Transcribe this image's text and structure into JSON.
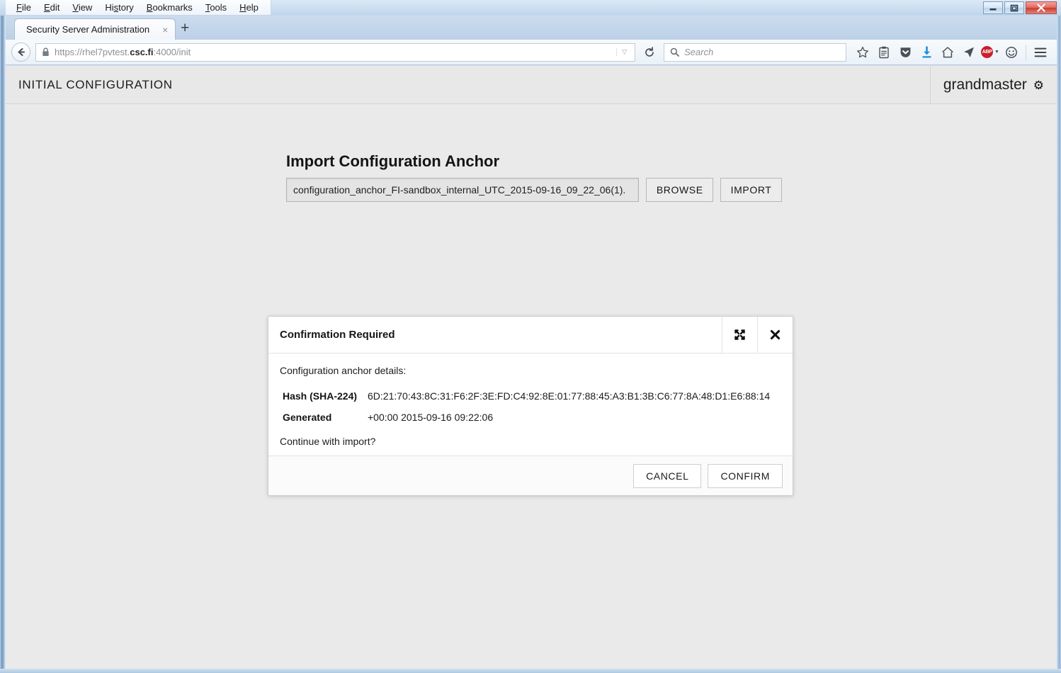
{
  "browser": {
    "window_controls": [
      {
        "name": "minimize",
        "glyph": "—"
      },
      {
        "name": "maximize",
        "glyph": "❐"
      },
      {
        "name": "close",
        "glyph": "✕"
      }
    ],
    "menus": [
      {
        "label": "File",
        "accel": "F"
      },
      {
        "label": "Edit",
        "accel": "E"
      },
      {
        "label": "View",
        "accel": "V"
      },
      {
        "label": "History",
        "accel": "s"
      },
      {
        "label": "Bookmarks",
        "accel": "B"
      },
      {
        "label": "Tools",
        "accel": "T"
      },
      {
        "label": "Help",
        "accel": "H"
      }
    ],
    "tab": {
      "label": "Security Server Administration",
      "close_glyph": "×",
      "new_tab_glyph": "+"
    },
    "url": {
      "prefix": "https://rhel7pvtest.",
      "domain": "csc.fi",
      "suffix": ":4000/init",
      "dropdown_glyph": "▽"
    },
    "search": {
      "placeholder": "Search"
    },
    "toolbar_icons": [
      "bookmark-star-icon",
      "reader-list-icon",
      "pocket-shield-icon",
      "downloads-icon",
      "home-icon",
      "sync-send-icon",
      "adblock-plus-icon",
      "feedback-smiley-icon",
      "hamburger-menu-icon"
    ],
    "adblock_label": "ABP"
  },
  "app": {
    "header": {
      "title": "INITIAL CONFIGURATION",
      "user": "grandmaster",
      "gear_glyph": "⚙"
    },
    "anchor": {
      "heading": "Import Configuration Anchor",
      "file_name": "configuration_anchor_FI-sandbox_internal_UTC_2015-09-16_09_22_06(1).",
      "browse_label": "BROWSE",
      "import_label": "IMPORT"
    },
    "dialog": {
      "title": "Confirmation Required",
      "maximize_glyph": "✖",
      "close_glyph": "✖",
      "intro": "Configuration anchor details:",
      "details": [
        {
          "label": "Hash (SHA-224)",
          "value": "6D:21:70:43:8C:31:F6:2F:3E:FD:C4:92:8E:01:77:88:45:A3:B1:3B:C6:77:8A:48:D1:E6:88:14"
        },
        {
          "label": "Generated",
          "value": "+00:00 2015-09-16 09:22:06"
        }
      ],
      "question": "Continue with import?",
      "cancel_label": "CANCEL",
      "confirm_label": "CONFIRM"
    }
  },
  "colors": {
    "page_bg": "#eaeaea",
    "header_bg": "#e8e8e8",
    "dialog_bg": "#ffffff",
    "close_button": "#c93c30",
    "download_blue": "#1e90d8",
    "abp_red": "#c8202a"
  }
}
